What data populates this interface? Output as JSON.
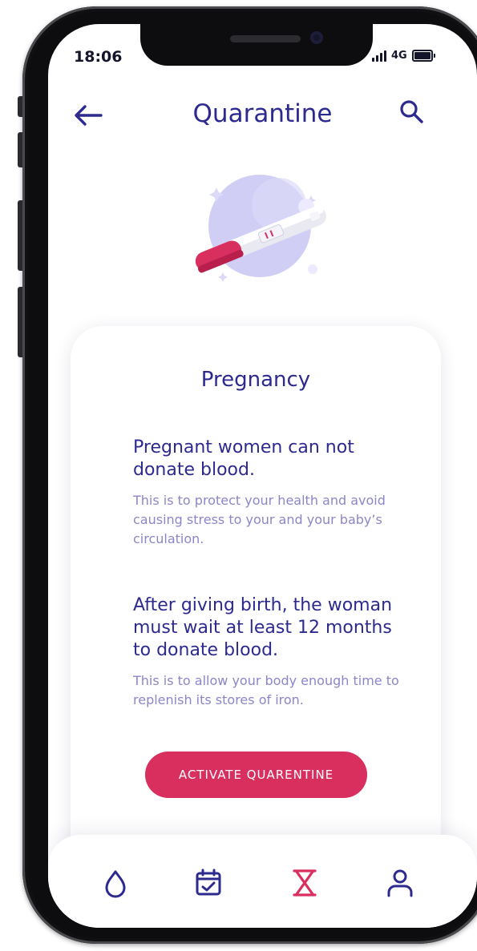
{
  "status": {
    "time": "18:06",
    "network": "4G"
  },
  "header": {
    "title": "Quarantine"
  },
  "card": {
    "title": "Pregnancy",
    "rules": [
      {
        "heading": "Pregnant women can not donate blood.",
        "body": "This is to protect your health and avoid causing stress to your and your baby’s circulation."
      },
      {
        "heading": "After giving birth, the woman must wait at least 12 months to donate blood.",
        "body": "This is to allow your body enough time to replenish its stores of iron."
      }
    ],
    "action_label": "ACTIVATE QUARENTINE"
  },
  "tabs": [
    {
      "icon": "drop-icon",
      "active": false
    },
    {
      "icon": "calendar-check-icon",
      "active": false
    },
    {
      "icon": "hourglass-icon",
      "active": true
    },
    {
      "icon": "user-icon",
      "active": false
    }
  ],
  "colors": {
    "primary": "#2d2a8f",
    "accent": "#d92f5f",
    "muted": "#8c86c8",
    "illustration_bg": "#c9c6f5"
  }
}
